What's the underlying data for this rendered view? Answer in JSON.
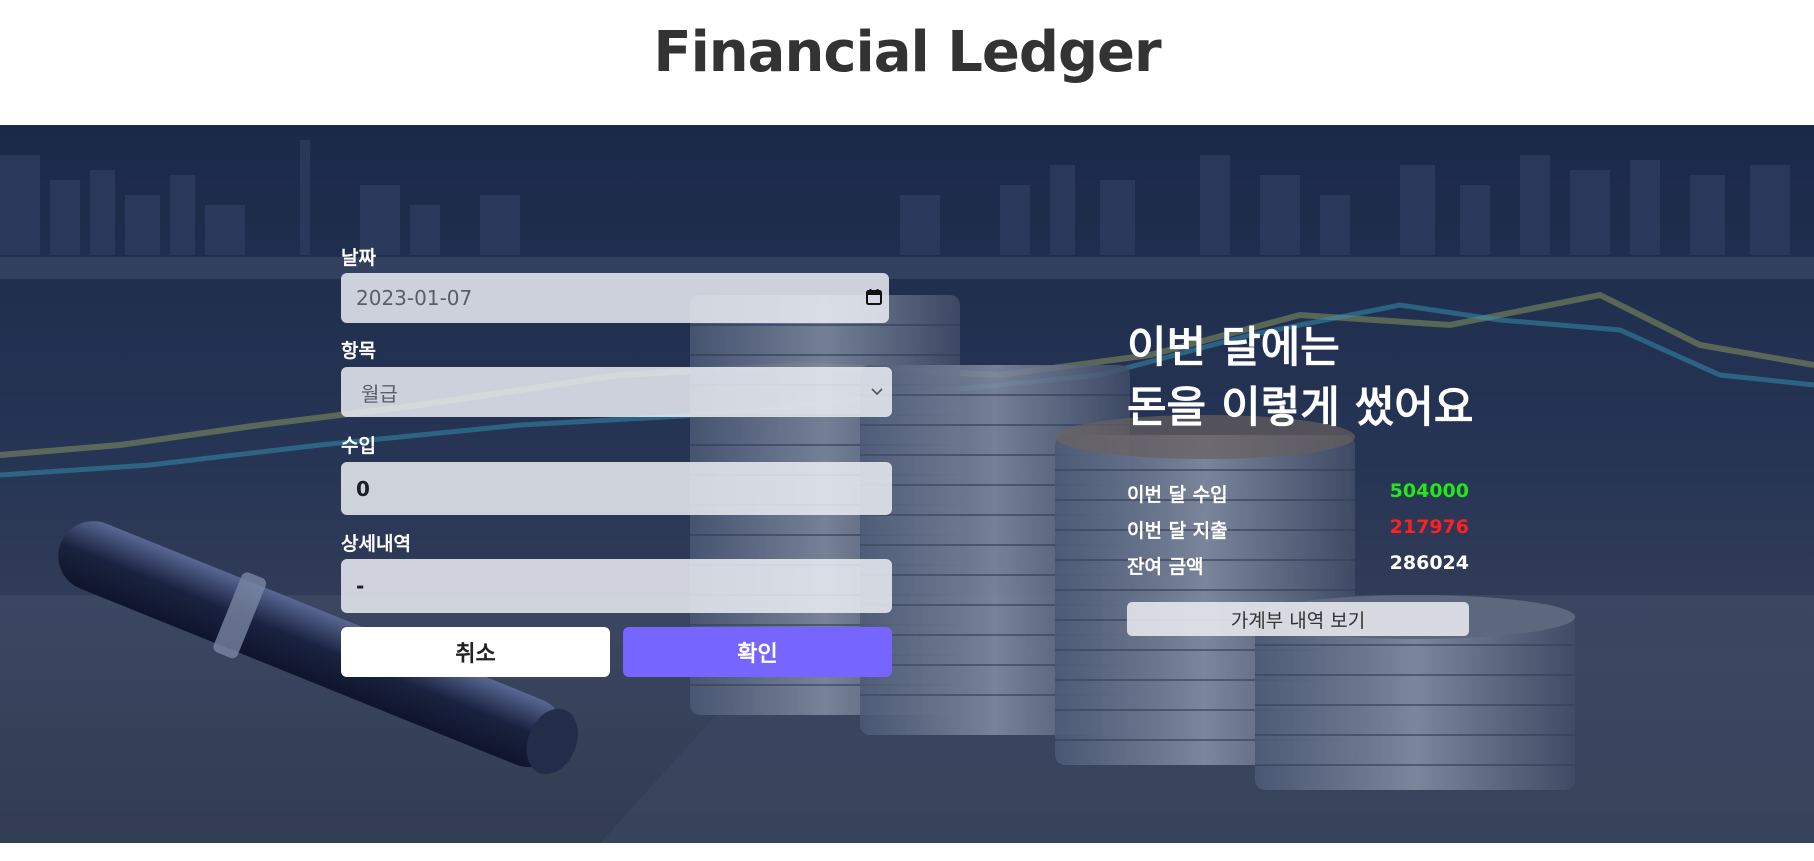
{
  "header": {
    "title": "Financial Ledger"
  },
  "form": {
    "date": {
      "label": "날짜",
      "value": "2023-01-07"
    },
    "category": {
      "label": "항목",
      "selected": "월급"
    },
    "income": {
      "label": "수입",
      "value": "0"
    },
    "detail": {
      "label": "상세내역",
      "value": "-"
    },
    "cancel_label": "취소",
    "confirm_label": "확인"
  },
  "summary": {
    "heading_line1": "이번 달에는",
    "heading_line2": "돈을 이렇게 썼어요",
    "income_label": "이번 달 수입",
    "income_value": "504000",
    "expense_label": "이번 달 지출",
    "expense_value": "217976",
    "balance_label": "잔여 금액",
    "balance_value": "286024",
    "view_button_label": "가계부 내역 보기"
  },
  "colors": {
    "accent": "#7666ff",
    "income": "#22e81a",
    "expense": "#ff2020",
    "title": "#333333"
  }
}
